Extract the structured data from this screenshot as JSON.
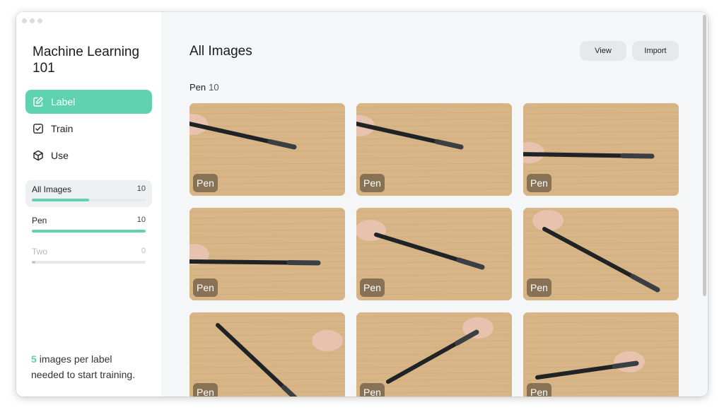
{
  "app": {
    "title": "Machine Learning 101"
  },
  "nav": [
    {
      "label": "Label",
      "active": true
    },
    {
      "label": "Train",
      "active": false
    },
    {
      "label": "Use",
      "active": false
    }
  ],
  "labels": [
    {
      "name": "All Images",
      "count": "10",
      "progress": 0.5,
      "selected": true,
      "dim": false
    },
    {
      "name": "Pen",
      "count": "10",
      "progress": 1.0,
      "selected": false,
      "dim": false
    },
    {
      "name": "Two",
      "count": "0",
      "progress": 0.0,
      "selected": false,
      "dim": true
    }
  ],
  "footer": {
    "number": "5",
    "line1": "images per label",
    "line2": "needed to start training."
  },
  "main": {
    "title": "All Images",
    "buttons": {
      "view": "View",
      "import": "Import"
    },
    "section": {
      "name": "Pen",
      "count": "10"
    }
  },
  "images": [
    {
      "tag": "Pen"
    },
    {
      "tag": "Pen"
    },
    {
      "tag": "Pen"
    },
    {
      "tag": "Pen"
    },
    {
      "tag": "Pen"
    },
    {
      "tag": "Pen"
    },
    {
      "tag": "Pen"
    },
    {
      "tag": "Pen"
    },
    {
      "tag": "Pen"
    }
  ],
  "colors": {
    "accent": "#5fd3ae",
    "wood": "#d7b586",
    "pen": "#1f2326"
  }
}
